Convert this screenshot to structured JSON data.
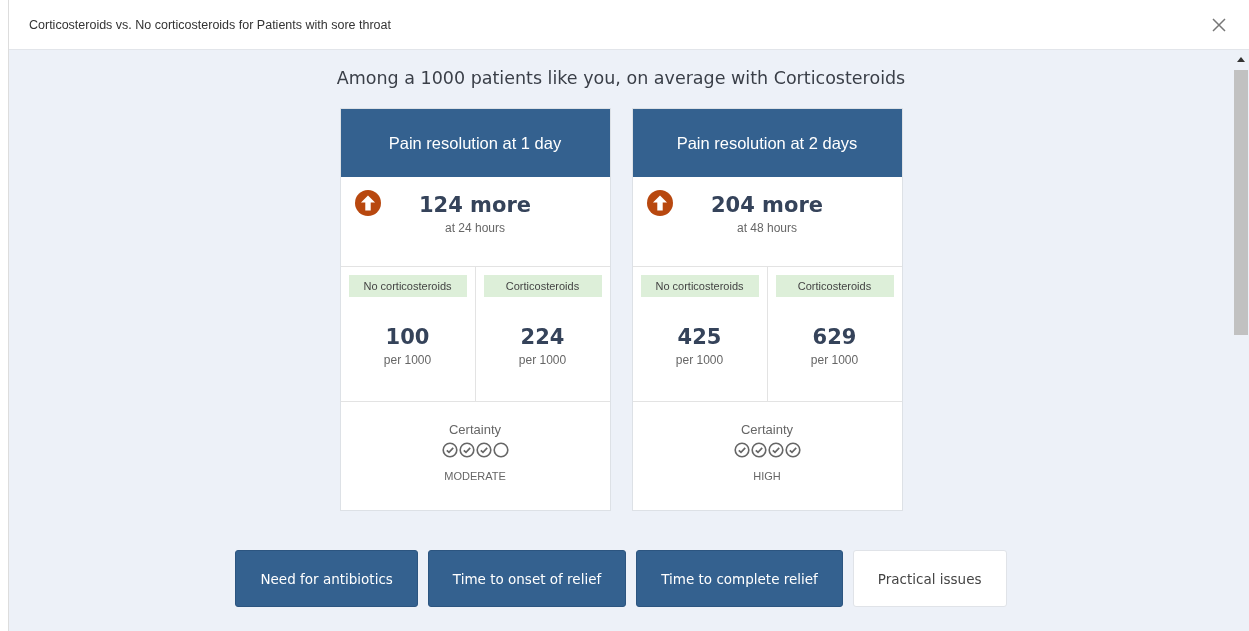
{
  "window": {
    "title": "Corticosteroids vs. No corticosteroids for Patients with sore throat"
  },
  "heading": "Among a 1000 patients like you, on average with Corticosteroids",
  "outcomes": [
    {
      "title": "Pain resolution at 1 day",
      "kind": "increase",
      "effect": "124 more",
      "timeframe": "at 24 hours",
      "arms": [
        {
          "label": "No corticosteroids",
          "value": "100",
          "unit": "per 1000"
        },
        {
          "label": "Corticosteroids",
          "value": "224",
          "unit": "per 1000"
        }
      ],
      "certainty_label": "Certainty",
      "certainty_marks": [
        {
          "checked": true
        },
        {
          "checked": true
        },
        {
          "checked": true
        },
        {
          "checked": false
        }
      ],
      "certainty": "MODERATE"
    },
    {
      "title": "Pain resolution at 2 days",
      "kind": "increase",
      "effect": "204 more",
      "timeframe": "at 48 hours",
      "arms": [
        {
          "label": "No corticosteroids",
          "value": "425",
          "unit": "per 1000"
        },
        {
          "label": "Corticosteroids",
          "value": "629",
          "unit": "per 1000"
        }
      ],
      "certainty_label": "Certainty",
      "certainty_marks": [
        {
          "checked": true
        },
        {
          "checked": true
        },
        {
          "checked": true
        },
        {
          "checked": true
        }
      ],
      "certainty": "HIGH"
    }
  ],
  "buttons": [
    {
      "label": "Need for antibiotics",
      "selected": false
    },
    {
      "label": "Time to onset of relief",
      "selected": false
    },
    {
      "label": "Time to complete relief",
      "selected": false
    },
    {
      "label": "Practical issues",
      "selected": true
    }
  ]
}
